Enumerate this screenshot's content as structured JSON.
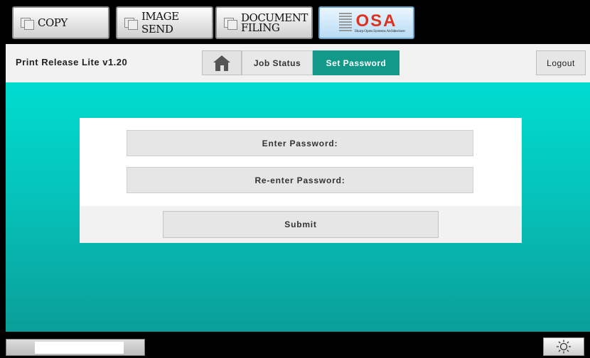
{
  "modebar": {
    "copy_label": "COPY",
    "image_send_label": "IMAGE SEND",
    "document_filing_line1": "DOCUMENT",
    "document_filing_line2": "FILING",
    "osa_label": "OSA",
    "osa_sub": "Sharp Open Systems Architecture"
  },
  "header": {
    "app_title": "Print Release Lite  v1.20",
    "tabs": [
      {
        "label": "Job Status",
        "active": false
      },
      {
        "label": "Set Password",
        "active": true
      }
    ],
    "logout_label": "Logout",
    "home_icon": "home-icon"
  },
  "form": {
    "enter_password_label": "Enter Password:",
    "reenter_password_label": "Re-enter Password:",
    "submit_label": "Submit"
  },
  "bottombar": {
    "brightness_icon": "brightness-icon"
  },
  "colors": {
    "accent": "#12998a",
    "teal_top": "#00dcd0",
    "teal_bottom": "#0a9e98"
  }
}
